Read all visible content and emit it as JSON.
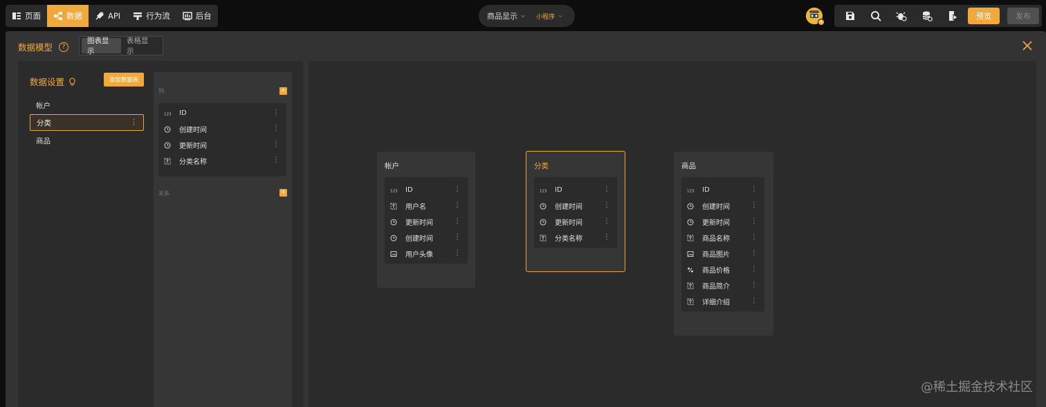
{
  "nav": {
    "items": [
      {
        "label": "页面",
        "icon": "page-icon",
        "active": false
      },
      {
        "label": "数据",
        "icon": "data-model-icon",
        "active": true
      },
      {
        "label": "API",
        "icon": "api-plug-icon",
        "active": false
      },
      {
        "label": "行为流",
        "icon": "flow-icon",
        "active": false
      },
      {
        "label": "后台",
        "icon": "admin-icon",
        "active": false
      }
    ]
  },
  "center": {
    "page_select": "商品显示",
    "platform_select": "小程序"
  },
  "toolbar": {
    "icons": [
      "save-icon",
      "search-icon",
      "debug-icon",
      "database-icon",
      "run-icon"
    ],
    "preview_label": "预览",
    "publish_label": "发布"
  },
  "panel": {
    "title": "数据模型",
    "help": "?",
    "view_toggle": [
      "图表显示",
      "表格显示"
    ],
    "active_view": "图表显示"
  },
  "settings": {
    "title": "数据设置",
    "add_table_label": "添加数据表",
    "tables": [
      {
        "name": "帐户",
        "selected": false
      },
      {
        "name": "分类",
        "selected": true
      },
      {
        "name": "商品",
        "selected": false
      }
    ]
  },
  "fields_panel": {
    "columns_label": "列",
    "relations_label": "关系",
    "fields": [
      {
        "name": "ID",
        "type": "number"
      },
      {
        "name": "创建时间",
        "type": "time"
      },
      {
        "name": "更新时间",
        "type": "time"
      },
      {
        "name": "分类名称",
        "type": "text"
      }
    ]
  },
  "cards": [
    {
      "title": "帐户",
      "selected": false,
      "fields": [
        {
          "name": "ID",
          "type": "number"
        },
        {
          "name": "用户名",
          "type": "text"
        },
        {
          "name": "更新时间",
          "type": "time"
        },
        {
          "name": "创建时间",
          "type": "time"
        },
        {
          "name": "用户头像",
          "type": "image"
        }
      ]
    },
    {
      "title": "分类",
      "selected": true,
      "fields": [
        {
          "name": "ID",
          "type": "number"
        },
        {
          "name": "创建时间",
          "type": "time"
        },
        {
          "name": "更新时间",
          "type": "time"
        },
        {
          "name": "分类名称",
          "type": "text"
        }
      ]
    },
    {
      "title": "商品",
      "selected": false,
      "fields": [
        {
          "name": "ID",
          "type": "number"
        },
        {
          "name": "创建时间",
          "type": "time"
        },
        {
          "name": "更新时间",
          "type": "time"
        },
        {
          "name": "商品名称",
          "type": "text"
        },
        {
          "name": "商品图片",
          "type": "image"
        },
        {
          "name": "商品价格",
          "type": "price"
        },
        {
          "name": "商品简介",
          "type": "text"
        },
        {
          "name": "详细介绍",
          "type": "text"
        }
      ]
    }
  ],
  "watermark": "@稀土掘金技术社区",
  "colors": {
    "accent": "#f2a93b",
    "bg": "#0d0d0d",
    "panel": "#333333",
    "card": "#363636"
  }
}
